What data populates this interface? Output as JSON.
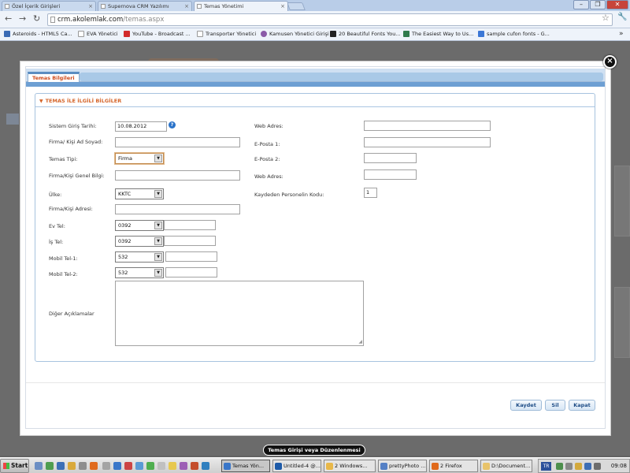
{
  "browser": {
    "tabs": [
      {
        "label": "Özel İçerik Girişleri"
      },
      {
        "label": "Supernova CRM Yazılımı"
      },
      {
        "label": "Temas Yönetimi"
      }
    ],
    "url_host": "crm.akolemlak.com",
    "url_path": "/temas.aspx",
    "bookmarks": [
      {
        "label": "Asteroids - HTML5 Ca...",
        "color": "#3a6bb5"
      },
      {
        "label": "EVA Yönetici",
        "color": "#ffffff"
      },
      {
        "label": "YouTube - Broadcast ...",
        "color": "#d22b2b"
      },
      {
        "label": "Transporter Yönetici",
        "color": "#ffffff"
      },
      {
        "label": "Kamusen Yönetici Girişi",
        "color": "#8a5aa8"
      },
      {
        "label": "20 Beautiful Fonts You...",
        "color": "#222222"
      },
      {
        "label": "The Easiest Way to Us...",
        "color": "#2f7a4c"
      },
      {
        "label": "sample cufon fonts - G...",
        "color": "#3b77d6"
      }
    ]
  },
  "modal": {
    "tab_label": "Temas Bilgileri",
    "section_title": "TEMAS İLE İLGİLİ BİLGİLER",
    "left": {
      "sistem_giris_tarihi": {
        "label": "Sistem Giriş Tarihi:",
        "value": "10.08.2012"
      },
      "firma_ad_soyad": {
        "label": "Firma/ Kişi Ad Soyad:",
        "value": ""
      },
      "temas_tipi": {
        "label": "Temas Tipi:",
        "value": "Firma"
      },
      "genel_bilgi": {
        "label": "Firma/Kişi Genel Bilgi:",
        "value": ""
      },
      "ulke": {
        "label": "Ülke:",
        "value": "KKTC"
      },
      "adres": {
        "label": "Firma/Kişi Adresi:",
        "value": ""
      },
      "ev_tel": {
        "label": "Ev Tel:",
        "code": "0392",
        "value": ""
      },
      "is_tel": {
        "label": "İş Tel:",
        "code": "0392",
        "value": ""
      },
      "mobil_1": {
        "label": "Mobil Tel-1:",
        "code": "532",
        "value": ""
      },
      "mobil_2": {
        "label": "Mobil Tel-2:",
        "code": "532",
        "value": ""
      },
      "aciklamalar": {
        "label": "Diğer Açıklamalar",
        "value": ""
      }
    },
    "right": {
      "web_adres_1": {
        "label": "Web Adres:",
        "value": ""
      },
      "eposta_1": {
        "label": "E-Posta 1:",
        "value": ""
      },
      "eposta_2": {
        "label": "E-Posta 2:",
        "value": ""
      },
      "web_adres_2": {
        "label": "Web Adres:",
        "value": ""
      },
      "personel_kodu": {
        "label": "Kaydeden Personelin Kodu:",
        "value": "1"
      }
    },
    "buttons": {
      "save": "Kaydet",
      "delete": "Sil",
      "close": "Kapat"
    },
    "caption": "Temas Girişi veya Düzenlenmesi"
  },
  "taskbar": {
    "start_label": "Start",
    "tasks": [
      {
        "label": "Temas Yön...",
        "color": "#3a77c9"
      },
      {
        "label": "Untitled-4 @...",
        "color": "#1d5aa8"
      },
      {
        "label": "2 Windows...",
        "color": "#e8b84a"
      },
      {
        "label": "prettyPhoto ...",
        "color": "#5580c5"
      },
      {
        "label": "2 Firefox",
        "color": "#e06a1c"
      },
      {
        "label": "D:\\Document...",
        "color": "#e8c36a"
      }
    ],
    "lang": "TR",
    "time": "09:08"
  },
  "colors": {
    "accent_orange": "#d5652a",
    "tab_blue": "#6d9fd3",
    "overlay": "#636363"
  }
}
